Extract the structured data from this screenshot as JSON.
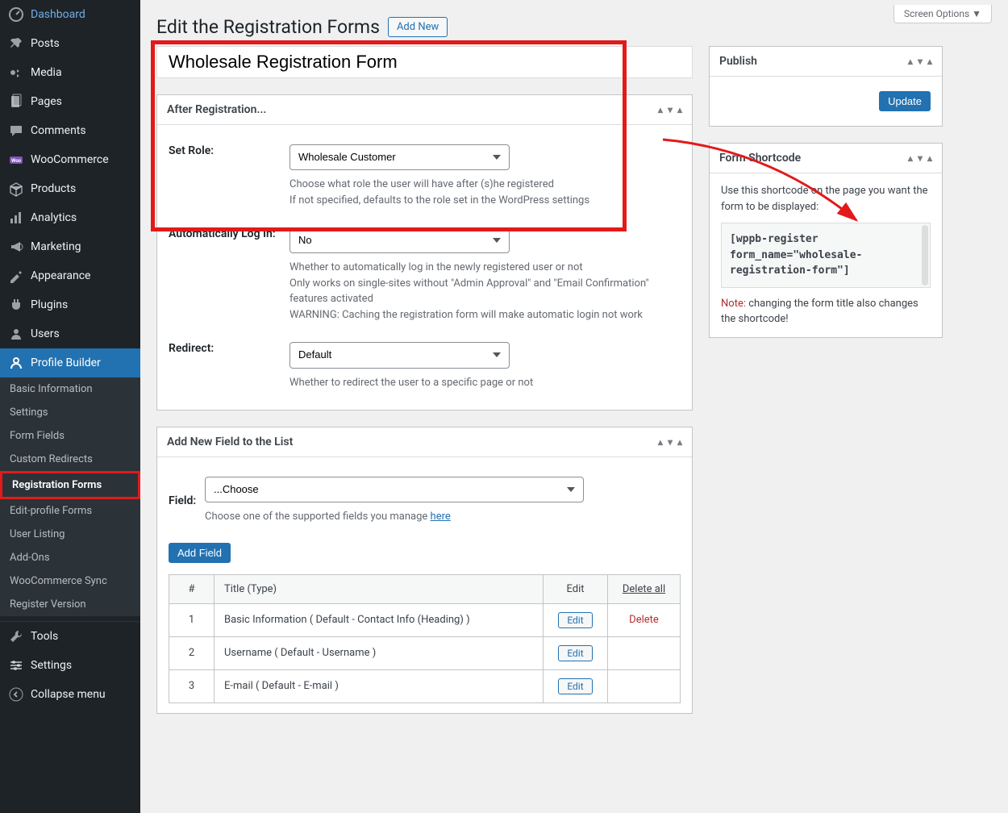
{
  "screen_options": "Screen Options ▼",
  "header": {
    "title": "Edit the Registration Forms",
    "add_new": "Add New"
  },
  "form_title": "Wholesale Registration Form",
  "sidebar": {
    "items": [
      {
        "label": "Dashboard",
        "icon": "dashboard"
      },
      {
        "label": "Posts",
        "icon": "pin"
      },
      {
        "label": "Media",
        "icon": "media"
      },
      {
        "label": "Pages",
        "icon": "page"
      },
      {
        "label": "Comments",
        "icon": "comment"
      },
      {
        "label": "WooCommerce",
        "icon": "woo"
      },
      {
        "label": "Products",
        "icon": "products"
      },
      {
        "label": "Analytics",
        "icon": "analytics"
      },
      {
        "label": "Marketing",
        "icon": "marketing"
      },
      {
        "label": "Appearance",
        "icon": "appearance"
      },
      {
        "label": "Plugins",
        "icon": "plugins"
      },
      {
        "label": "Users",
        "icon": "users"
      },
      {
        "label": "Profile Builder",
        "icon": "profile"
      },
      {
        "label": "Tools",
        "icon": "tools"
      },
      {
        "label": "Settings",
        "icon": "settings"
      },
      {
        "label": "Collapse menu",
        "icon": "collapse"
      }
    ],
    "active_index": 12,
    "submenu": [
      "Basic Information",
      "Settings",
      "Form Fields",
      "Custom Redirects",
      "Registration Forms",
      "Edit-profile Forms",
      "User Listing",
      "Add-Ons",
      "WooCommerce Sync",
      "Register Version"
    ],
    "submenu_current": 4
  },
  "after_reg": {
    "title": "After Registration...",
    "set_role_label": "Set Role:",
    "set_role_value": "Wholesale Customer",
    "set_role_desc1": "Choose what role the user will have after (s)he registered",
    "set_role_desc2": "If not specified, defaults to the role set in the WordPress settings",
    "auto_login_label": "Automatically Log In:",
    "auto_login_value": "No",
    "auto_login_desc": "Whether to automatically log in the newly registered user or not\nOnly works on single-sites without \"Admin Approval\" and \"Email Confirmation\" features activated\nWARNING: Caching the registration form will make automatic login not work",
    "redirect_label": "Redirect:",
    "redirect_value": "Default",
    "redirect_desc": "Whether to redirect the user to a specific page or not"
  },
  "add_field": {
    "title": "Add New Field to the List",
    "field_label": "Field:",
    "field_value": "...Choose",
    "field_desc_pre": "Choose one of the supported fields you manage ",
    "field_desc_link": "here",
    "add_btn": "Add Field",
    "table": {
      "headers": [
        "#",
        "Title (Type)",
        "Edit",
        "Delete all"
      ],
      "rows": [
        {
          "n": "1",
          "title": "Basic Information ( Default - Contact Info (Heading) )",
          "edit": "Edit",
          "del": "Delete"
        },
        {
          "n": "2",
          "title": "Username ( Default - Username )",
          "edit": "Edit",
          "del": ""
        },
        {
          "n": "3",
          "title": "E-mail ( Default - E-mail )",
          "edit": "Edit",
          "del": ""
        }
      ]
    }
  },
  "publish": {
    "title": "Publish",
    "update": "Update"
  },
  "shortcode": {
    "title": "Form Shortcode",
    "intro": "Use this shortcode on the page you want the form to be displayed:",
    "code": "[wppb-register form_name=\"wholesale-registration-form\"]",
    "note_label": "Note:",
    "note_text": " changing the form title also changes the shortcode!"
  }
}
